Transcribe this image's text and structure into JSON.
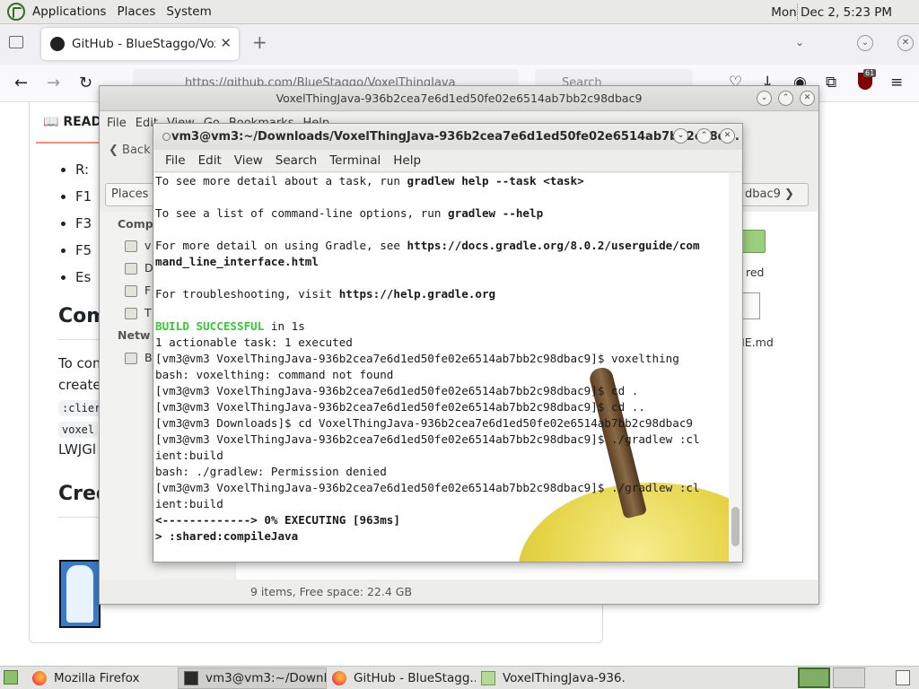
{
  "top_panel": {
    "menu": [
      "Applications",
      "Places",
      "System"
    ],
    "clock": "Mon Dec  2,  5:23 PM"
  },
  "firefox": {
    "tab_title": "GitHub - BlueStaggo/VoxelThingJava",
    "url": "https://github.com/BlueStaggo/VoxelThingJava",
    "search_placeholder": "Search",
    "ublock_badge": "61",
    "github": {
      "readme_tab": "README",
      "bullets": [
        "R:",
        "F1",
        "F3",
        "F5",
        "Es"
      ],
      "heading_compile": "Com",
      "text_1": "To com",
      "text_2": "create",
      "code_1": ":clier",
      "code_2": "voxel",
      "text_3": "LWJGl",
      "heading_credits": "Cred"
    }
  },
  "file_manager": {
    "title": "VoxelThingJava-936b2cea7e6d1ed50fe02e6514ab7bb2c98dbac9",
    "menu": [
      "File",
      "Edit",
      "View",
      "Go",
      "Bookmarks",
      "Help"
    ],
    "back_label": "Back",
    "places_button": "Places",
    "path_button": "dbac9",
    "sidebar_computer": "Comp",
    "sidebar_network": "Netw",
    "sidebar_items": [
      "v",
      "D",
      "F",
      "T"
    ],
    "network_item": "B",
    "files": [
      "red",
      "ME.md"
    ],
    "status": "9 items, Free space: 22.4 GB"
  },
  "terminal": {
    "title": "vm3@vm3:~/Downloads/VoxelThingJava-936b2cea7e6d1ed50fe02e6514ab7bb2c98d...",
    "menu": [
      "File",
      "Edit",
      "View",
      "Search",
      "Terminal",
      "Help"
    ],
    "lines": [
      {
        "parts": [
          {
            "t": "To see more detail about a task, run "
          },
          {
            "t": "gradlew help --task <task>",
            "s": "b"
          }
        ]
      },
      {
        "parts": [
          {
            "t": ""
          }
        ]
      },
      {
        "parts": [
          {
            "t": "To see a list of command-line options, run "
          },
          {
            "t": "gradlew --help",
            "s": "b"
          }
        ]
      },
      {
        "parts": [
          {
            "t": ""
          }
        ]
      },
      {
        "parts": [
          {
            "t": "For more detail on using Gradle, see "
          },
          {
            "t": "https://docs.gradle.org/8.0.2/userguide/com",
            "s": "b"
          }
        ]
      },
      {
        "parts": [
          {
            "t": "mand_line_interface.html",
            "s": "b"
          }
        ]
      },
      {
        "parts": [
          {
            "t": ""
          }
        ]
      },
      {
        "parts": [
          {
            "t": "For troubleshooting, visit "
          },
          {
            "t": "https://help.gradle.org",
            "s": "b"
          }
        ]
      },
      {
        "parts": [
          {
            "t": ""
          }
        ]
      },
      {
        "parts": [
          {
            "t": "BUILD SUCCESSFUL",
            "s": "g"
          },
          {
            "t": " in 1s"
          }
        ]
      },
      {
        "parts": [
          {
            "t": "1 actionable task: 1 executed"
          }
        ]
      },
      {
        "parts": [
          {
            "t": "[vm3@vm3 VoxelThingJava-936b2cea7e6d1ed50fe02e6514ab7bb2c98dbac9]$ voxelthing"
          }
        ]
      },
      {
        "parts": [
          {
            "t": "bash: voxelthing: command not found"
          }
        ]
      },
      {
        "parts": [
          {
            "t": "[vm3@vm3 VoxelThingJava-936b2cea7e6d1ed50fe02e6514ab7bb2c98dbac9]$ cd ."
          }
        ]
      },
      {
        "parts": [
          {
            "t": "[vm3@vm3 VoxelThingJava-936b2cea7e6d1ed50fe02e6514ab7bb2c98dbac9]$ cd .."
          }
        ]
      },
      {
        "parts": [
          {
            "t": "[vm3@vm3 Downloads]$ cd VoxelThingJava-936b2cea7e6d1ed50fe02e6514ab7bb2c98dbac9"
          }
        ]
      },
      {
        "parts": [
          {
            "t": "[vm3@vm3 VoxelThingJava-936b2cea7e6d1ed50fe02e6514ab7bb2c98dbac9]$ ./gradlew :cl"
          }
        ]
      },
      {
        "parts": [
          {
            "t": "ient:build"
          }
        ]
      },
      {
        "parts": [
          {
            "t": "bash: ./gradlew: Permission denied"
          }
        ]
      },
      {
        "parts": [
          {
            "t": "[vm3@vm3 VoxelThingJava-936b2cea7e6d1ed50fe02e6514ab7bb2c98dbac9]$ ./gradlew :cl"
          }
        ]
      },
      {
        "parts": [
          {
            "t": "ient:build"
          }
        ]
      },
      {
        "parts": [
          {
            "t": "<-------------> 0% EXECUTING [963ms]",
            "s": "b"
          }
        ]
      },
      {
        "parts": [
          {
            "t": "> :shared:compileJava",
            "s": "b"
          }
        ]
      }
    ]
  },
  "taskbar": {
    "tasks": [
      {
        "label": "Mozilla Firefox",
        "icon": "firefox-icon"
      },
      {
        "label": "vm3@vm3:~/Downl...",
        "icon": "terminal-icon"
      },
      {
        "label": "GitHub - BlueStagg...",
        "icon": "firefox-icon"
      },
      {
        "label": "VoxelThingJava-936...",
        "icon": "folder-icon"
      }
    ]
  }
}
